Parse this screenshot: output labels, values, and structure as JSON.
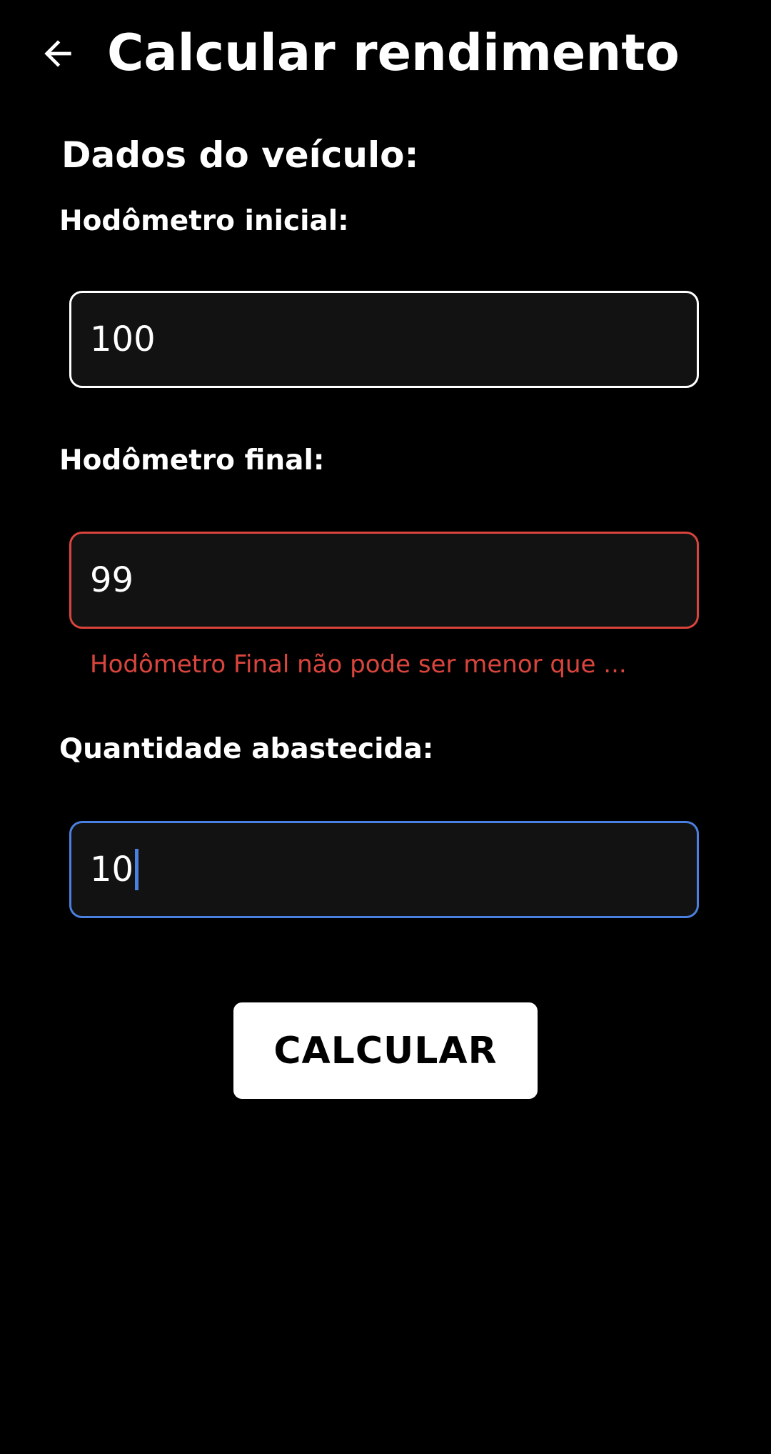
{
  "header": {
    "title": "Calcular rendimento",
    "back_icon": "arrow-left-icon"
  },
  "section": {
    "title": "Dados do veículo:"
  },
  "fields": {
    "odometer_start": {
      "label": "Hodômetro inicial:",
      "value": "100"
    },
    "odometer_end": {
      "label": "Hodômetro final:",
      "value": "99",
      "error": "Hodômetro Final não pode ser menor que ..."
    },
    "fuel_amount": {
      "label": "Quantidade abastecida:",
      "value": "10"
    }
  },
  "actions": {
    "calculate_label": "CALCULAR"
  },
  "colors": {
    "background": "#000000",
    "field_fill": "#121212",
    "error": "#d9453d",
    "focus": "#4a80e0",
    "button": "#ffffff"
  }
}
